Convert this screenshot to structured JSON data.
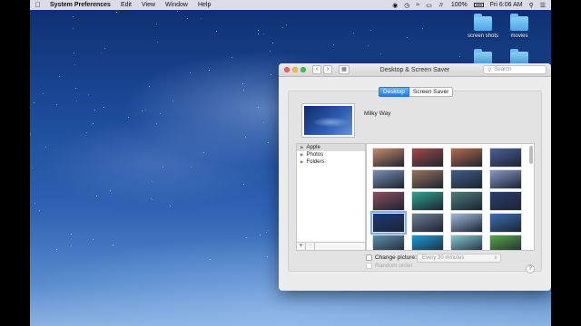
{
  "menubar": {
    "app_name": "System Preferences",
    "items": [
      "Edit",
      "View",
      "Window",
      "Help"
    ],
    "battery": "100%",
    "clock": "Fri 6:06 AM"
  },
  "desktop_icons": [
    {
      "label": "screen shots",
      "icon": "folder-icon"
    },
    {
      "label": "movies",
      "icon": "folder-icon"
    },
    {
      "label": "",
      "icon": "folder-icon"
    },
    {
      "label": "",
      "icon": "folder-icon"
    }
  ],
  "window": {
    "title": "Desktop & Screen Saver",
    "search_placeholder": "Search",
    "tabs": [
      "Desktop",
      "Screen Saver"
    ],
    "selected_tab": "Desktop",
    "wallpaper_name": "Milky Way",
    "sources": [
      {
        "label": "Apple",
        "selected": true
      },
      {
        "label": "Photos",
        "selected": false
      },
      {
        "label": "Folders",
        "selected": false
      }
    ],
    "add_label": "+",
    "remove_label": "−",
    "change_picture_label": "Change picture:",
    "interval_value": "Every 30 minutes",
    "random_order_label": "Random order",
    "help_label": "?"
  },
  "thumbnail_colors": [
    [
      "#c98a6a",
      "#a24b45",
      "#b76a4a",
      "#4c5f9a"
    ],
    [
      "#7a8fb0",
      "#9a7258",
      "#3f5d85",
      "#8a97c8"
    ],
    [
      "#8f4f5e",
      "#2fa28e",
      "#4d7d7a",
      "#2a3d6e"
    ],
    [
      "#1b3a7a",
      "#6d7f93",
      "#9fbcd9",
      "#3a6fb0"
    ],
    [
      "#5f8ea8",
      "#1a9ad6",
      "#86c6cf",
      "#5aa646"
    ]
  ]
}
